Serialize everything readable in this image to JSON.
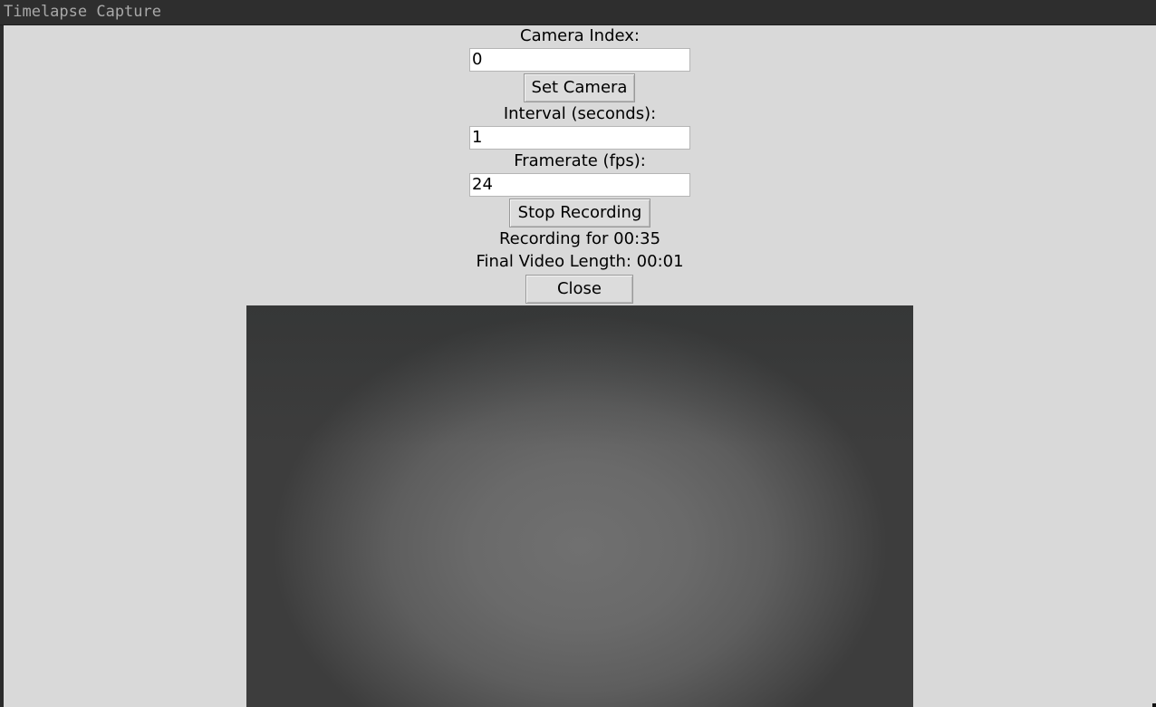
{
  "window": {
    "title": "Timelapse Capture"
  },
  "camera": {
    "label": "Camera Index:",
    "value": "0",
    "set_button": "Set Camera"
  },
  "interval": {
    "label": "Interval (seconds):",
    "value": "1"
  },
  "framerate": {
    "label": "Framerate (fps):",
    "value": "24"
  },
  "recording": {
    "toggle_button": "Stop Recording",
    "status": "Recording for 00:35",
    "final_length": "Final Video Length: 00:01"
  },
  "close_button": "Close",
  "colors": {
    "window_bg": "#d9d9d9",
    "titlebar_bg": "#2e2e2e",
    "title_text": "#a8a8a8"
  }
}
